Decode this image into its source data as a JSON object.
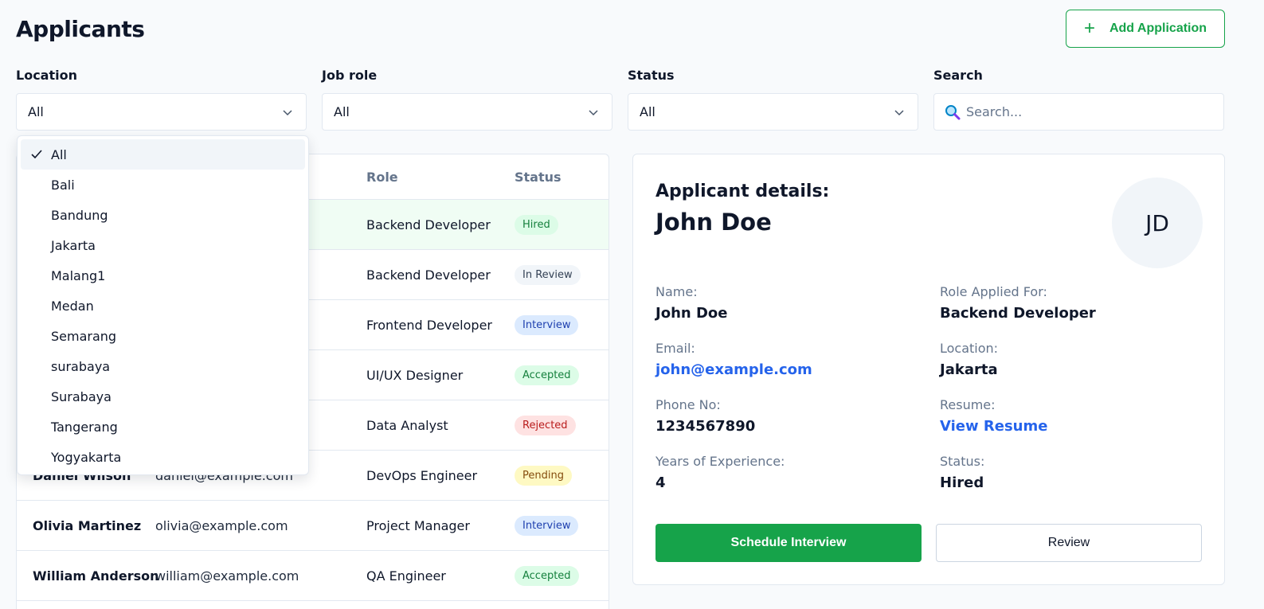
{
  "header": {
    "title": "Applicants",
    "add_button_label": "Add Application",
    "add_icon": "plus-icon"
  },
  "filters": {
    "location": {
      "label": "Location",
      "value": "All"
    },
    "job_role": {
      "label": "Job role",
      "value": "All"
    },
    "status": {
      "label": "Status",
      "value": "All"
    },
    "search": {
      "label": "Search",
      "placeholder": "Search...",
      "icon": "search-icon"
    }
  },
  "location_dropdown": {
    "selected": "All",
    "options": [
      "All",
      "Bali",
      "Bandung",
      "Jakarta",
      "Malang1",
      "Medan",
      "Semarang",
      "surabaya",
      "Surabaya",
      "Tangerang",
      "Yogyakarta"
    ]
  },
  "table": {
    "columns": {
      "role": "Role",
      "status": "Status"
    },
    "rows": [
      {
        "name": "",
        "email": "",
        "role": "Backend Developer",
        "status": "Hired"
      },
      {
        "name": "",
        "email": "",
        "role": "Backend Developer",
        "status": "In Review"
      },
      {
        "name": "",
        "email": "",
        "role": "Frontend Developer",
        "status": "Interview"
      },
      {
        "name": "",
        "email": "",
        "role": "UI/UX Designer",
        "status": "Accepted"
      },
      {
        "name": "",
        "email": "",
        "role": "Data Analyst",
        "status": "Rejected"
      },
      {
        "name": "Daniel Wilson",
        "email": "daniel@example.com",
        "role": "DevOps Engineer",
        "status": "Pending"
      },
      {
        "name": "Olivia Martinez",
        "email": "olivia@example.com",
        "role": "Project Manager",
        "status": "Interview"
      },
      {
        "name": "William Anderson",
        "email": "william@example.com",
        "role": "QA Engineer",
        "status": "Accepted"
      }
    ]
  },
  "details": {
    "heading": "Applicant details:",
    "name": "John Doe",
    "initials": "JD",
    "fields": {
      "name_label": "Name:",
      "name_value": "John Doe",
      "role_label": "Role Applied For:",
      "role_value": "Backend Developer",
      "email_label": "Email:",
      "email_value": "john@example.com",
      "location_label": "Location:",
      "location_value": "Jakarta",
      "phone_label": "Phone No:",
      "phone_value": "1234567890",
      "resume_label": "Resume:",
      "resume_value": "View Resume",
      "experience_label": "Years of Experience:",
      "experience_value": "4",
      "status_label": "Status:",
      "status_value": "Hired"
    },
    "schedule_button": "Schedule Interview",
    "review_button": "Review"
  },
  "colors": {
    "accent": "#16a34a",
    "link": "#2563eb",
    "background": "#f8fafc"
  }
}
